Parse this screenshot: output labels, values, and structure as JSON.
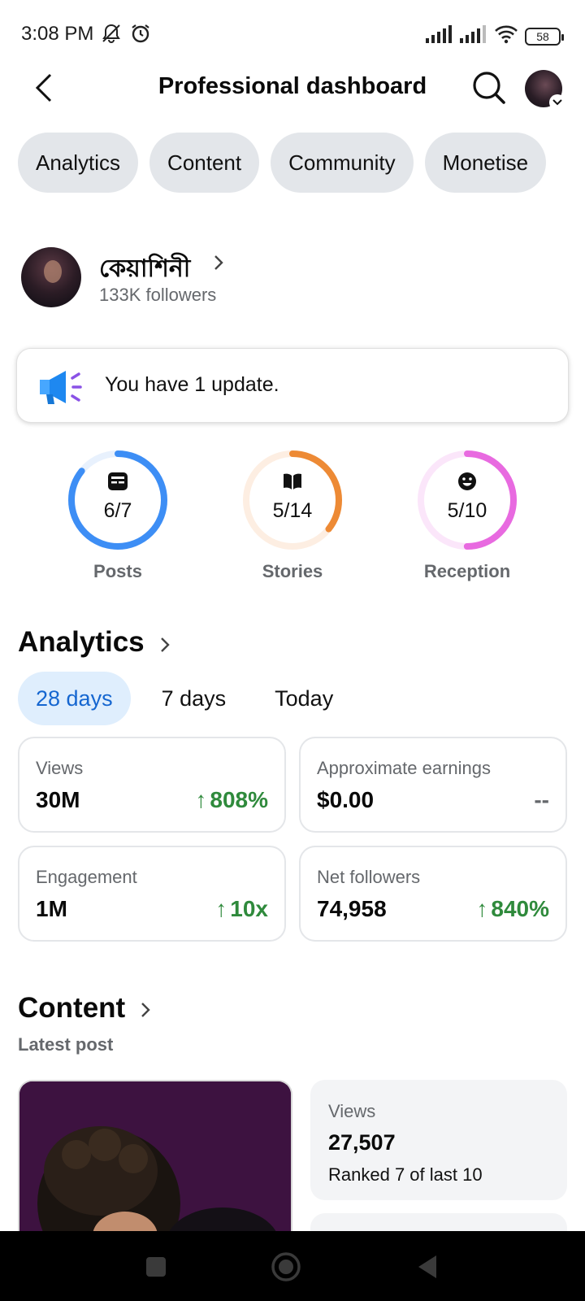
{
  "status_bar": {
    "time": "3:08 PM",
    "battery": "58",
    "icons": [
      "mute-icon",
      "alarm-icon",
      "signal-icon",
      "signal-icon",
      "wifi-icon",
      "battery-icon"
    ]
  },
  "header": {
    "title": "Professional dashboard"
  },
  "tabs": [
    {
      "label": "Analytics"
    },
    {
      "label": "Content"
    },
    {
      "label": "Community"
    },
    {
      "label": "Monetise"
    }
  ],
  "profile": {
    "name": "কেয়াশিনী",
    "followers": "133K followers"
  },
  "update": {
    "text": "You have 1 update."
  },
  "progress": [
    {
      "label": "Posts",
      "value": "6/7",
      "fraction": 0.857,
      "color": "#3d8ef5",
      "track": "#e8f1fd",
      "icon": "posts-icon"
    },
    {
      "label": "Stories",
      "value": "5/14",
      "fraction": 0.357,
      "color": "#ed8a35",
      "track": "#fdeee2",
      "icon": "book-icon"
    },
    {
      "label": "Reception",
      "value": "5/10",
      "fraction": 0.5,
      "color": "#e86ae0",
      "track": "#fbe6fa",
      "icon": "smile-icon"
    }
  ],
  "analytics": {
    "title": "Analytics",
    "periods": [
      {
        "label": "28 days"
      },
      {
        "label": "7 days"
      },
      {
        "label": "Today"
      }
    ],
    "stats": [
      {
        "label": "Views",
        "value": "30M",
        "change": "808%",
        "arrow": "↑"
      },
      {
        "label": "Approximate earnings",
        "value": "$0.00",
        "change": "--",
        "arrow": ""
      },
      {
        "label": "Engagement",
        "value": "1M",
        "change": "10x",
        "arrow": "↑"
      },
      {
        "label": "Net followers",
        "value": "74,958",
        "change": "840%",
        "arrow": "↑"
      }
    ]
  },
  "content": {
    "title": "Content",
    "subtitle": "Latest post",
    "post_stat": {
      "label": "Views",
      "value": "27,507",
      "rank": "Ranked 7 of last 10"
    }
  },
  "colors": {
    "accent": "#1566d0",
    "positive": "#2f8a3c",
    "muted": "#65686c"
  }
}
